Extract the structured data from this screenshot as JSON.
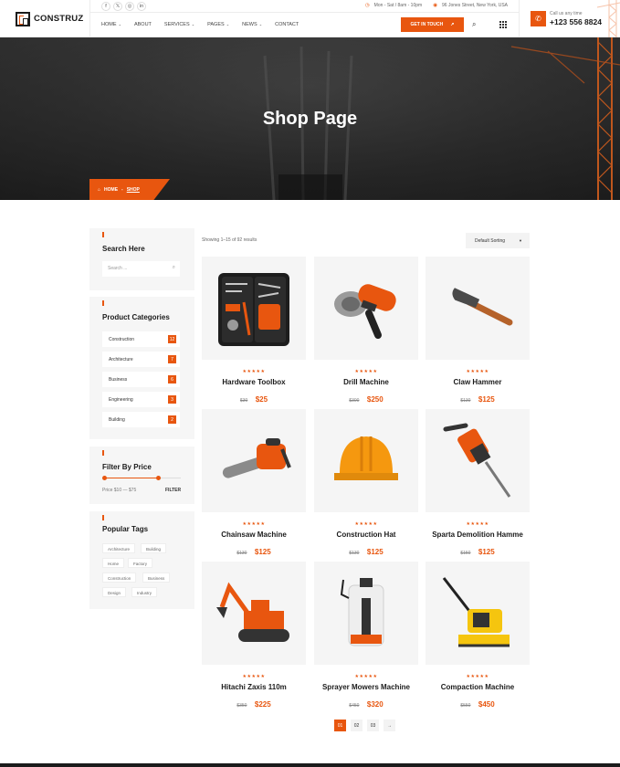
{
  "brand": {
    "name": "CONSTRUZ",
    "accent": "#e8560f"
  },
  "topbar": {
    "social": [
      "f",
      "𝕏",
      "◎",
      "in"
    ],
    "hours": "Mon - Sat / 8am - 10pm",
    "address": "96 Jones Street, New York, USA"
  },
  "nav": {
    "items": [
      "HOME",
      "ABOUT",
      "SERVICES",
      "PAGES",
      "NEWS",
      "CONTACT"
    ],
    "cta": "GET IN TOUCH"
  },
  "call": {
    "label": "Call us any time",
    "number": "+123 556 8824"
  },
  "hero": {
    "title": "Shop Page"
  },
  "breadcrumb": {
    "home": "HOME",
    "sep": "-",
    "current": "SHOP"
  },
  "sidebar": {
    "search": {
      "title": "Search Here",
      "placeholder": "Search ..."
    },
    "categories": {
      "title": "Product Categories",
      "items": [
        {
          "label": "Construction",
          "count": "12"
        },
        {
          "label": "Architecture",
          "count": "7"
        },
        {
          "label": "Business",
          "count": "6"
        },
        {
          "label": "Engineering",
          "count": "3"
        },
        {
          "label": "Building",
          "count": "2"
        }
      ]
    },
    "price": {
      "title": "Filter By Price",
      "range": "Price $10 — $75",
      "filter": "FILTER",
      "range_fraction": [
        0,
        0.7
      ]
    },
    "tags": {
      "title": "Popular Tags",
      "items": [
        "Architecture",
        "Building",
        "Home",
        "Factory",
        "Construction",
        "Business",
        "Design",
        "Industry"
      ]
    }
  },
  "shop": {
    "showing": "Showing 1–15 of 92 results",
    "sort": "Default Sorting",
    "products": [
      {
        "name": "Hardware Toolbox",
        "old": "$30",
        "price": "$25",
        "stars": "★★★★★",
        "icon": "toolbox"
      },
      {
        "name": "Drill Machine",
        "old": "$300",
        "price": "$250",
        "stars": "★★★★★",
        "icon": "angle-grinder"
      },
      {
        "name": "Claw Hammer",
        "old": "$130",
        "price": "$125",
        "stars": "★★★★★",
        "icon": "hammer"
      },
      {
        "name": "Chainsaw Machine",
        "old": "$130",
        "price": "$125",
        "stars": "★★★★★",
        "icon": "chainsaw"
      },
      {
        "name": "Construction Hat",
        "old": "$130",
        "price": "$125",
        "stars": "★★★★★",
        "icon": "hard-hat"
      },
      {
        "name": "Sparta Demolition Hamme",
        "old": "$150",
        "price": "$125",
        "stars": "★★★★★",
        "icon": "jackhammer"
      },
      {
        "name": "Hitachi Zaxis 110m",
        "old": "$350",
        "price": "$225",
        "stars": "★★★★★",
        "icon": "excavator"
      },
      {
        "name": "Sprayer Mowers Machine",
        "old": "$450",
        "price": "$320",
        "stars": "★★★★★",
        "icon": "backpack-sprayer"
      },
      {
        "name": "Compaction Machine",
        "old": "$550",
        "price": "$450",
        "stars": "★★★★★",
        "icon": "plate-compactor"
      }
    ]
  },
  "pagination": {
    "pages": [
      "01",
      "02",
      "03"
    ],
    "next": "→"
  }
}
